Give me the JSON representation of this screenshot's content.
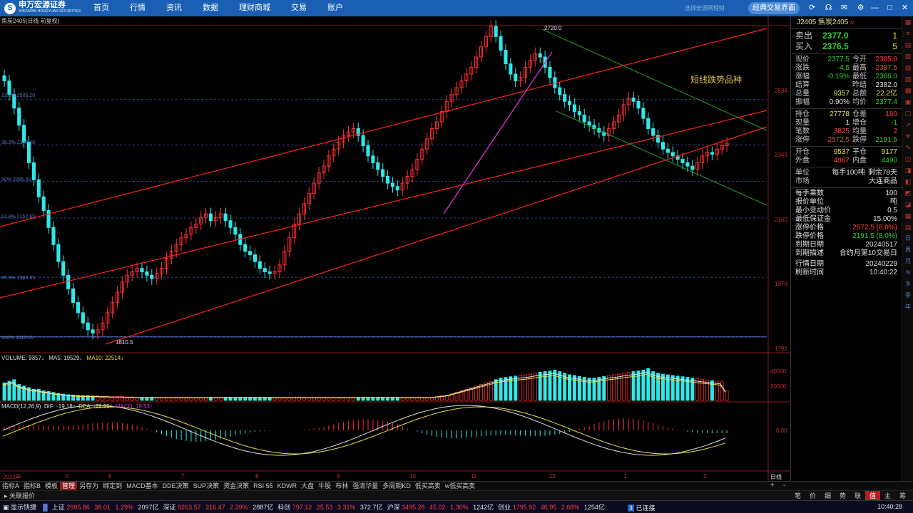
{
  "app": {
    "logo_cn": "申万宏源证券",
    "logo_en": "SHENWAN HONGYUAN SECURITIES",
    "nav": [
      "首页",
      "行情",
      "资讯",
      "数据",
      "理财商城",
      "交易",
      "账户"
    ],
    "slogan": "选择宏源网理财",
    "classic_button": "经典交易界面",
    "icons": [
      "sync-icon",
      "headset-icon",
      "mail-icon",
      "gear-icon",
      "minimize-icon",
      "maximize-icon",
      "close-icon"
    ]
  },
  "chart": {
    "title": "焦炭2405(日线 前复权)",
    "annotation": "短线跌势品种",
    "high_label": "2720.0",
    "low_label": "1810.5",
    "fib": [
      {
        "label": "23.6% 2505.20",
        "value": 2505.2
      },
      {
        "label": "38.2% 2372.40",
        "value": 2372.4
      },
      {
        "label": "50% 2265.02",
        "value": 2265.02
      },
      {
        "label": "61.8% 2157.65",
        "value": 2157.65
      },
      {
        "label": "80.9% 1983.85",
        "value": 1983.85
      },
      {
        "label": "100% 1810.05",
        "value": 1810.05
      }
    ],
    "price_axis": [
      "2534",
      "2349",
      "2163",
      "1978",
      "1792"
    ],
    "volume_axis": [
      "40000",
      "20000"
    ],
    "macd_axis": "0.00",
    "months": [
      "2023年",
      "5",
      "6",
      "7",
      "8",
      "9",
      "10",
      "11",
      "12",
      "1",
      "2"
    ],
    "period": "日线",
    "volume_header": {
      "vol": "VOLUME: 9357",
      "ma5": "MA5: 19529",
      "ma10": "MA10: 22514"
    },
    "macd_header": {
      "name": "MACD(12,26,9)",
      "dif": "DIF: -19.18",
      "dea": "DEA: -28.95",
      "macd": "MACD: 19.53"
    },
    "colors": {
      "up": "#ff3030",
      "down": "#30e8e8",
      "channel": "#ff2020",
      "down_channel": "#2a9a2a",
      "magenta": "#d030d0"
    }
  },
  "chart_data": {
    "type": "candlestick",
    "price_range": [
      1792,
      2720
    ],
    "price_close": [
      2560,
      2520,
      2480,
      2430,
      2380,
      2320,
      2270,
      2220,
      2180,
      2130,
      2080,
      2030,
      1990,
      1950,
      1910,
      1880,
      1850,
      1830,
      1820,
      1830,
      1850,
      1880,
      1910,
      1940,
      1970,
      1990,
      2000,
      2010,
      2000,
      1990,
      1980,
      1995,
      2010,
      2040,
      2060,
      2080,
      2100,
      2110,
      2130,
      2140,
      2160,
      2170,
      2150,
      2160,
      2170,
      2150,
      2130,
      2110,
      2080,
      2060,
      2050,
      2030,
      2010,
      2000,
      1995,
      2000,
      2020,
      2060,
      2100,
      2140,
      2170,
      2200,
      2230,
      2260,
      2290,
      2310,
      2340,
      2360,
      2380,
      2400,
      2410,
      2420,
      2400,
      2370,
      2340,
      2320,
      2300,
      2280,
      2260,
      2250,
      2240,
      2260,
      2280,
      2300,
      2330,
      2360,
      2390,
      2420,
      2440,
      2470,
      2500,
      2520,
      2540,
      2560,
      2580,
      2600,
      2630,
      2660,
      2690,
      2720,
      2690,
      2650,
      2610,
      2580,
      2560,
      2570,
      2600,
      2620,
      2640,
      2630,
      2600,
      2570,
      2540,
      2520,
      2500,
      2490,
      2470,
      2460,
      2440,
      2430,
      2420,
      2410,
      2400,
      2420,
      2440,
      2460,
      2490,
      2510,
      2500,
      2480,
      2450,
      2420,
      2400,
      2380,
      2360,
      2350,
      2340,
      2330,
      2320,
      2310,
      2300,
      2320,
      2340,
      2350,
      2345,
      2360,
      2370,
      2377.5
    ],
    "volume_relative": [
      0.55,
      0.6,
      0.65,
      0.5,
      0.45,
      0.4,
      0.35,
      0.35,
      0.3,
      0.28,
      0.25,
      0.22,
      0.2,
      0.18,
      0.17,
      0.16,
      0.15,
      0.15,
      0.14,
      0.14,
      0.13,
      0.13,
      0.12,
      0.12,
      0.12,
      0.11,
      0.11,
      0.1,
      0.1,
      0.1,
      0.1,
      0.1,
      0.1,
      0.1,
      0.1,
      0.1,
      0.1,
      0.1,
      0.1,
      0.1,
      0.1,
      0.1,
      0.1,
      0.1,
      0.1,
      0.1,
      0.1,
      0.1,
      0.1,
      0.1,
      0.1,
      0.1,
      0.1,
      0.1,
      0.1,
      0.1,
      0.1,
      0.1,
      0.1,
      0.1,
      0.1,
      0.1,
      0.1,
      0.1,
      0.1,
      0.1,
      0.1,
      0.1,
      0.1,
      0.1,
      0.1,
      0.1,
      0.1,
      0.1,
      0.1,
      0.1,
      0.1,
      0.1,
      0.1,
      0.1,
      0.1,
      0.1,
      0.1,
      0.1,
      0.1,
      0.1,
      0.1,
      0.1,
      0.12,
      0.14,
      0.16,
      0.2,
      0.25,
      0.3,
      0.35,
      0.4,
      0.45,
      0.5,
      0.55,
      0.6,
      0.65,
      0.7,
      0.72,
      0.74,
      0.76,
      0.78,
      0.8,
      0.82,
      0.85,
      0.88,
      0.9,
      0.92,
      0.95,
      0.9,
      0.85,
      0.8,
      0.78,
      0.75,
      0.72,
      0.7,
      0.7,
      0.72,
      0.75,
      0.78,
      0.8,
      0.82,
      0.85,
      0.88,
      0.9,
      0.92,
      0.95,
      1.0,
      0.9,
      0.85,
      0.82,
      0.8,
      0.78,
      0.76,
      0.74,
      0.72,
      0.7,
      0.68,
      0.66,
      0.64,
      0.62,
      0.6,
      0.58,
      0.3
    ]
  },
  "quote": {
    "title": "J2405 焦炭2405",
    "title_sub": "M",
    "sell": {
      "label": "卖出",
      "price": "2377.0",
      "vol": "1"
    },
    "buy": {
      "label": "买入",
      "price": "2376.5",
      "vol": "5"
    },
    "rows1": [
      {
        "l1": "现价",
        "v1": "2377.5",
        "c1": "green",
        "l2": "今开",
        "v2": "2385.0",
        "c2": "red"
      },
      {
        "l1": "涨跌",
        "v1": "-4.5",
        "c1": "green",
        "l2": "最高",
        "v2": "2387.5",
        "c2": "red"
      },
      {
        "l1": "涨幅",
        "v1": "-0.19%",
        "c1": "green",
        "l2": "最低",
        "v2": "2366.0",
        "c2": "green"
      },
      {
        "l1": "结算",
        "v1": "",
        "c1": "white",
        "l2": "昨结",
        "v2": "2382.0",
        "c2": "white"
      },
      {
        "l1": "总量",
        "v1": "9357",
        "c1": "yellow",
        "l2": "总额",
        "v2": "22.2亿",
        "c2": "yellow"
      },
      {
        "l1": "振幅",
        "v1": "0.90%",
        "c1": "white",
        "l2": "均价",
        "v2": "2377.4",
        "c2": "green"
      }
    ],
    "rows2": [
      {
        "l1": "持仓",
        "v1": "27778",
        "c1": "yellow",
        "l2": "仓差",
        "v2": "180",
        "c2": "red"
      },
      {
        "l1": "现量",
        "v1": "1",
        "c1": "white",
        "l2": "增仓",
        "v2": "-1",
        "c2": "green"
      },
      {
        "l1": "笔数",
        "v1": "3825",
        "c1": "red",
        "l2": "均量",
        "v2": "2",
        "c2": "red"
      },
      {
        "l1": "涨停",
        "v1": "2572.5",
        "c1": "red",
        "l2": "跌停",
        "v2": "2191.5",
        "c2": "green"
      }
    ],
    "rows3": [
      {
        "l1": "开仓",
        "v1": "9537",
        "c1": "yellow",
        "l2": "平仓",
        "v2": "9177",
        "c2": "yellow"
      },
      {
        "l1": "外盘",
        "v1": "4867",
        "c1": "red",
        "l2": "内盘",
        "v2": "4490",
        "c2": "green"
      }
    ],
    "unit_row": {
      "l1": "单位",
      "v1": "每手100吨",
      "v2": "剩余78天"
    },
    "market_row": {
      "l1": "市场",
      "v1": "大连商品"
    },
    "info": [
      {
        "label": "每手乘数",
        "value": "100",
        "color": "white"
      },
      {
        "label": "报价单位",
        "value": "吨",
        "color": "white"
      },
      {
        "label": "最小变动价",
        "value": "0.5",
        "color": "white"
      },
      {
        "label": "最低保证金",
        "value": "15.00%",
        "color": "white"
      },
      {
        "label": "涨停价格",
        "value": "2572.5 (8.0%)",
        "color": "red"
      },
      {
        "label": "跌停价格",
        "value": "2191.5 (8.0%)",
        "color": "green"
      },
      {
        "label": "到期日期",
        "value": "20240517",
        "color": "white"
      },
      {
        "label": "到期描述",
        "value": "合约月第10交易日",
        "color": "white"
      },
      {
        "label": "行情日期",
        "value": "20240229",
        "color": "white"
      },
      {
        "label": "刷新时间",
        "value": "10:40:22",
        "color": "white"
      }
    ]
  },
  "right_tools": [
    "日",
    "周",
    "月",
    "N",
    "多",
    "季",
    "年"
  ],
  "tabs": [
    "指标A",
    "指标B",
    "模板",
    "管理",
    "另存为",
    "绑定到",
    "MACD基本",
    "DDE决策",
    "SUP决策",
    "资金决策",
    "RSI 55",
    "KDWR",
    "大盘",
    "牛股",
    "布林",
    "强清华量",
    "多周期KD",
    "低买高卖",
    "w低买高卖"
  ],
  "active_tab": "管理",
  "link_bar": "关联报价",
  "rb_tabs": [
    "笔",
    "价",
    "细",
    "势",
    "联",
    "值",
    "主",
    "筹"
  ],
  "rb_active": "值",
  "status": {
    "show": "显示快捷",
    "items": [
      {
        "name": "上证",
        "value": "2995.86",
        "chg": "38.01",
        "pct": "1.29%",
        "amt": "2097亿"
      },
      {
        "name": "深证",
        "value": "9263.57",
        "chg": "216.47",
        "pct": "2.39%",
        "amt": "2887亿"
      },
      {
        "name": "科创",
        "value": "797.12",
        "chg": "25.53",
        "pct": "3.31%",
        "amt": "372.7亿"
      },
      {
        "name": "沪深",
        "value": "3495.28",
        "chg": "45.02",
        "pct": "1.30%",
        "amt": "1242亿"
      },
      {
        "name": "创业",
        "value": "1795.92",
        "chg": "46.95",
        "pct": "2.68%",
        "amt": "1254亿"
      }
    ],
    "conn": "已连接",
    "clock": "10:40:28"
  }
}
